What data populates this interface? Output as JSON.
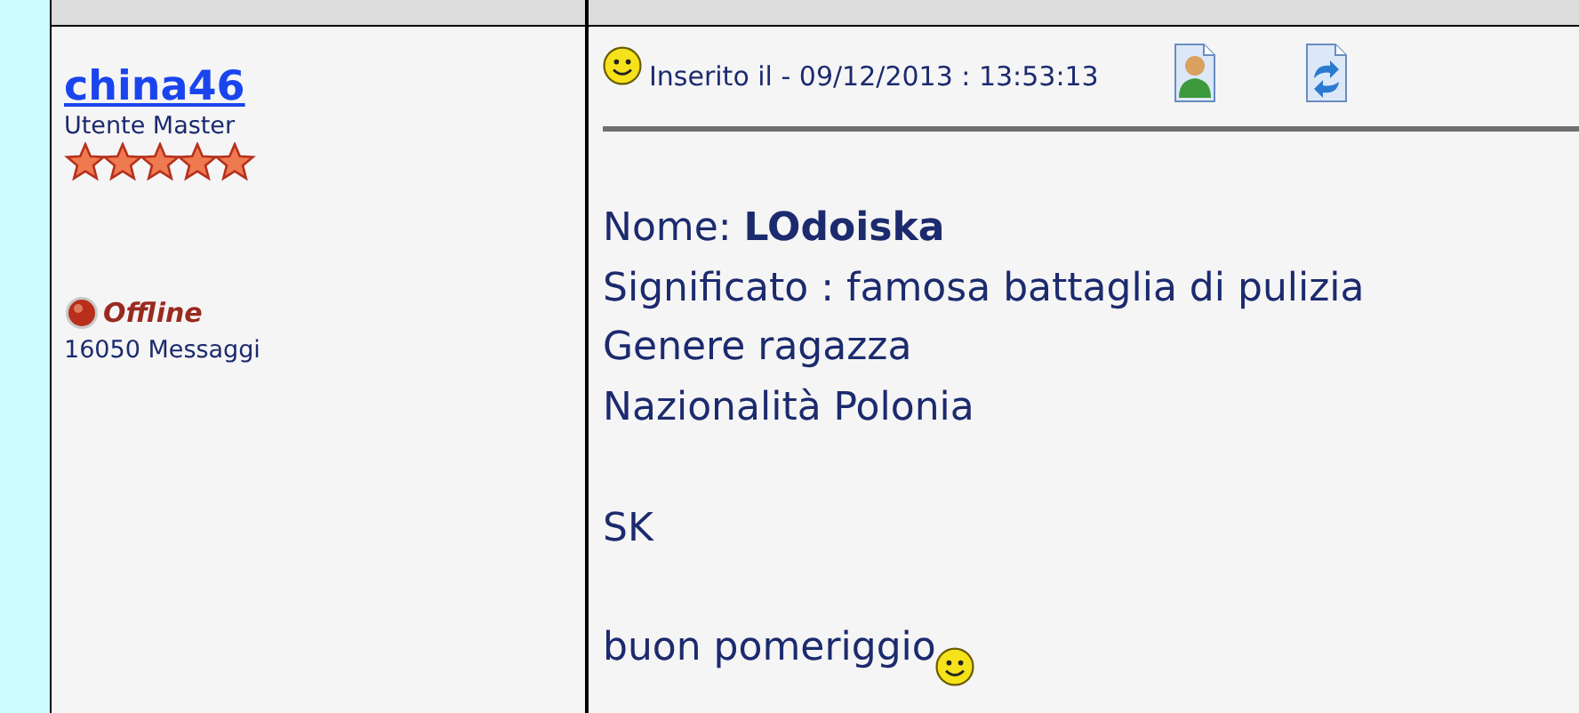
{
  "author": {
    "name": "china46",
    "rank": "Utente Master",
    "stars": 5,
    "status": "Offline",
    "posts": "16050 Messaggi"
  },
  "post": {
    "posted": "Inserito il - 09/12/2013 : 13:53:13",
    "paragraphs": [
      [
        "Nome: **LOdoiska**",
        "Significato : famosa battaglia di pulizia",
        "Genere ragazza",
        "Nazionalità Polonia"
      ],
      [
        "SK"
      ],
      [
        "buon pomeriggio"
      ]
    ]
  }
}
